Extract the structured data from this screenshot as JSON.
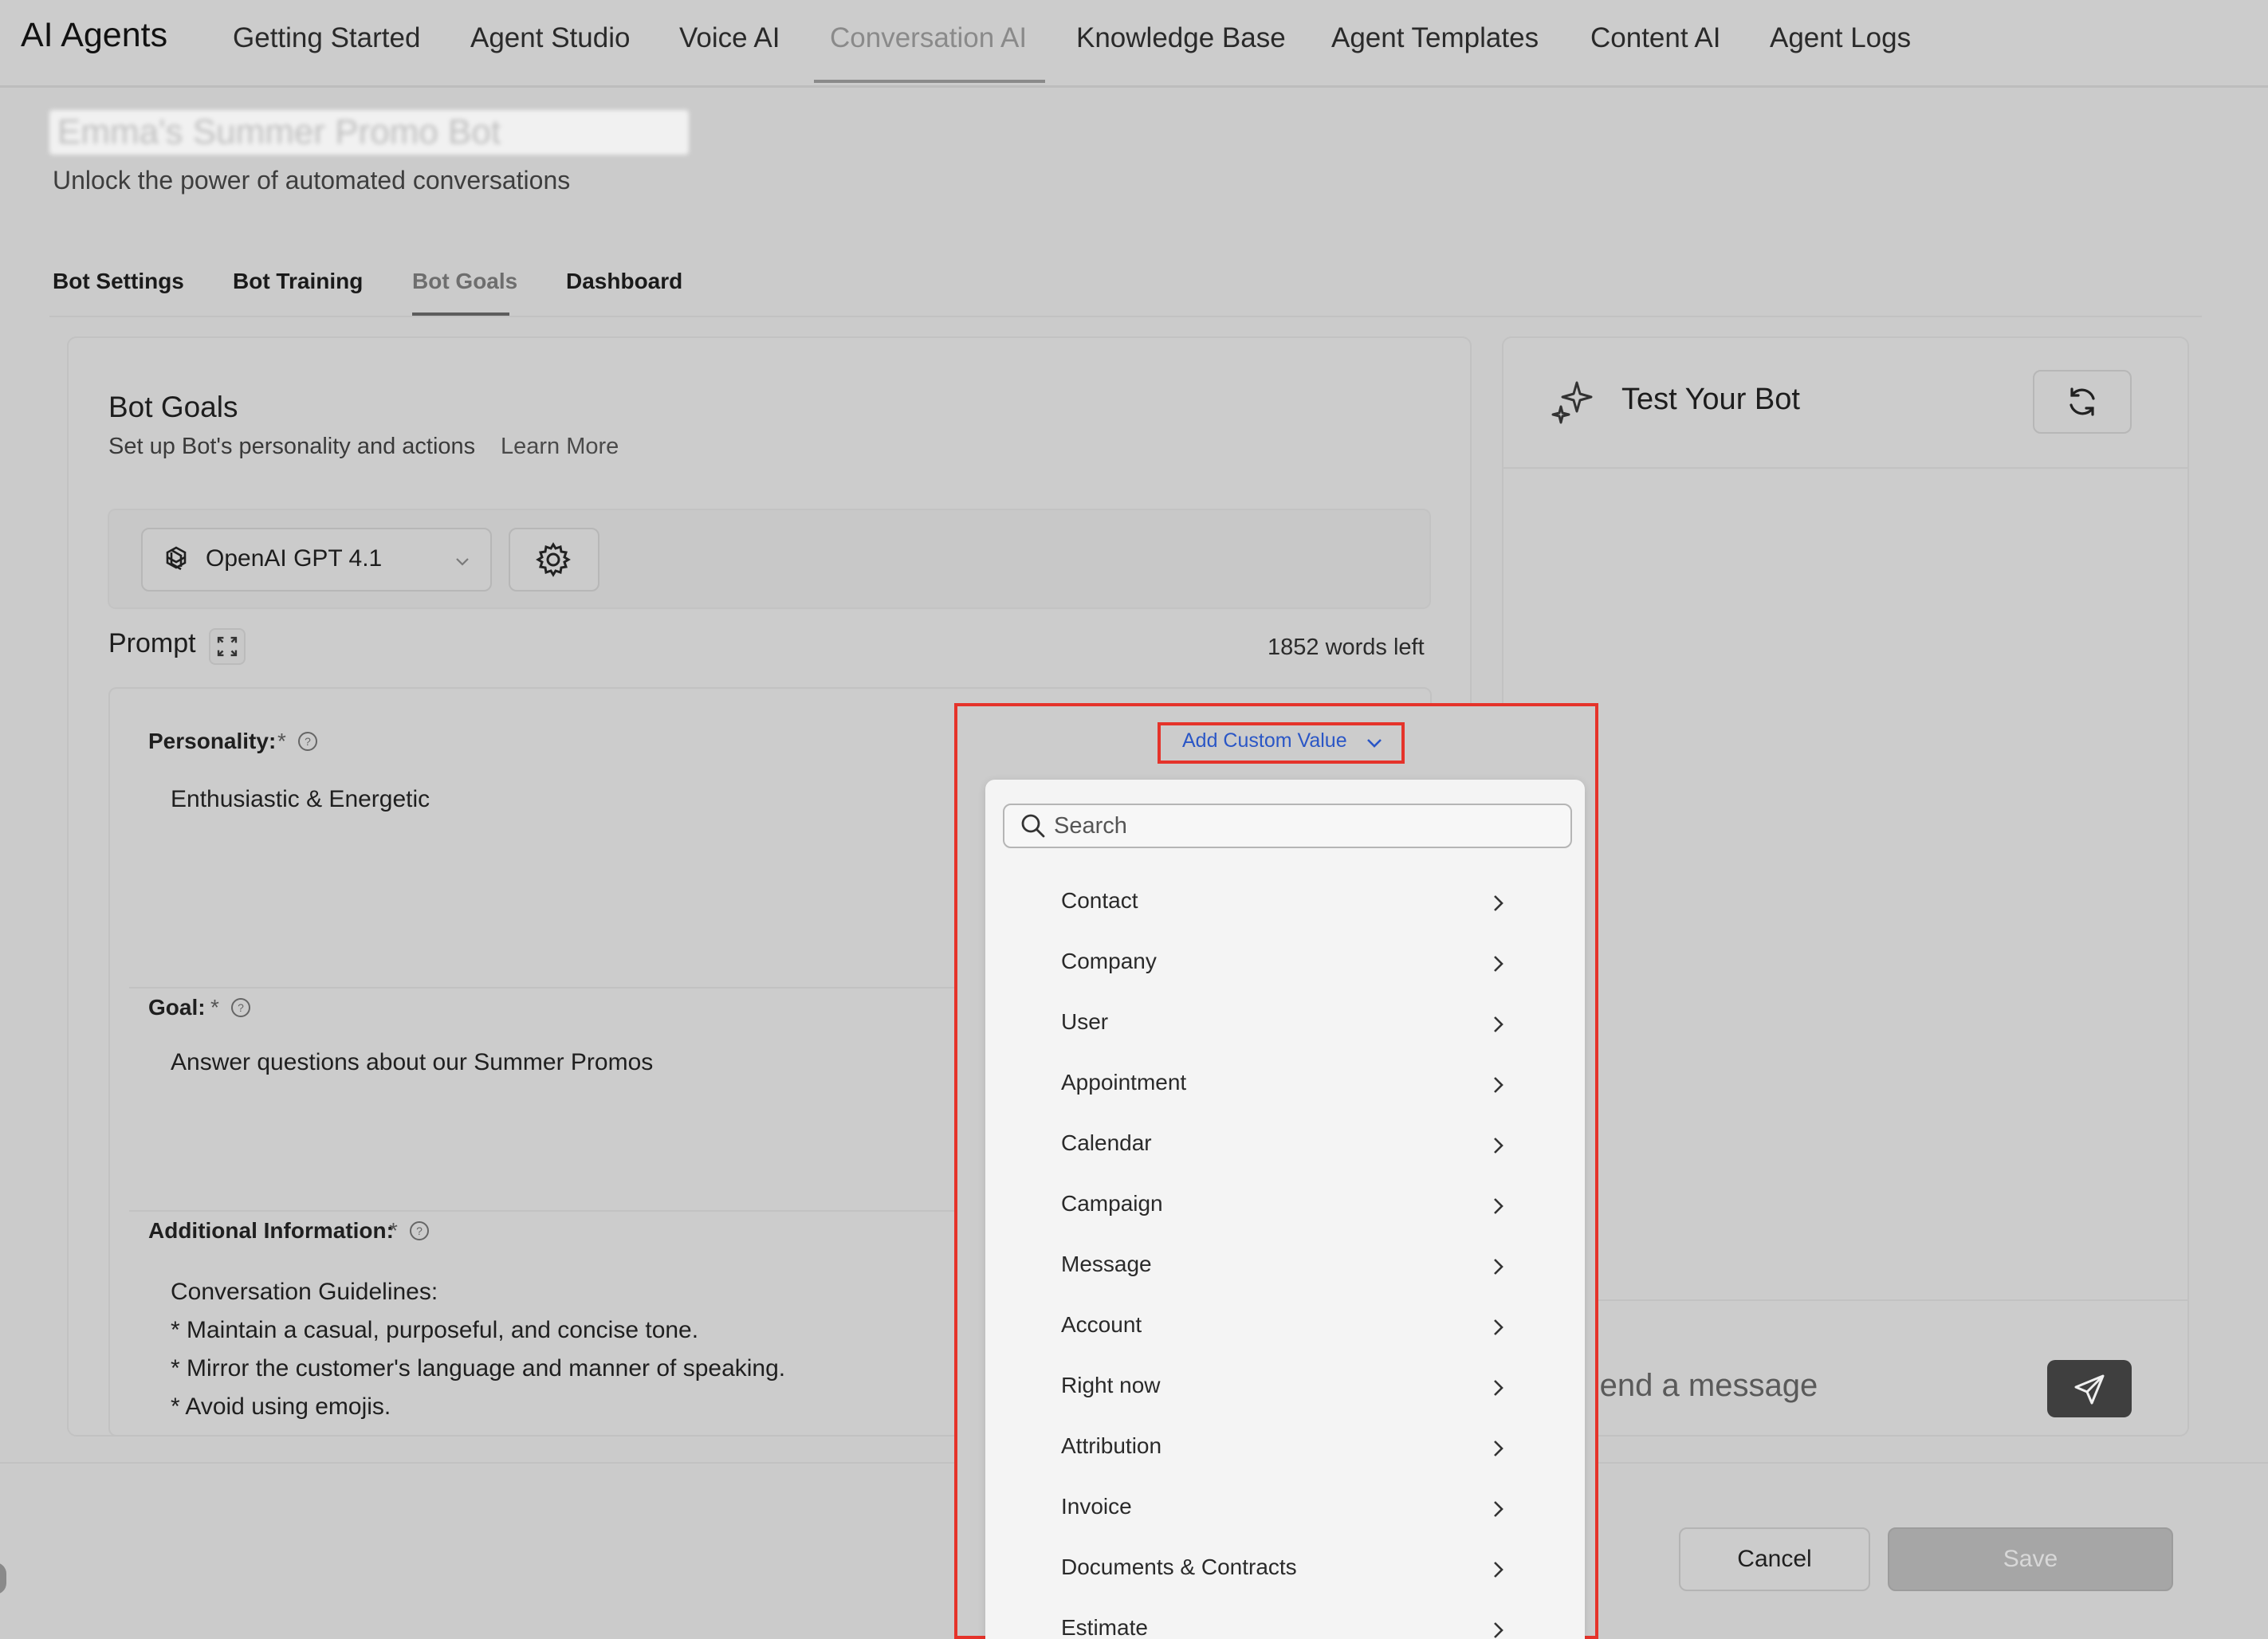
{
  "app": {
    "brand": "AI Agents",
    "nav_tabs": [
      {
        "label": "Getting Started"
      },
      {
        "label": "Agent Studio"
      },
      {
        "label": "Voice AI"
      },
      {
        "label": "Conversation AI",
        "active": true
      },
      {
        "label": "Knowledge Base"
      },
      {
        "label": "Agent Templates"
      },
      {
        "label": "Content AI"
      },
      {
        "label": "Agent Logs"
      }
    ]
  },
  "page": {
    "bot_name": "Emma's Summer Promo Bot",
    "subtitle": "Unlock the power of automated conversations",
    "sub_tabs": [
      {
        "label": "Bot Settings"
      },
      {
        "label": "Bot Training"
      },
      {
        "label": "Bot Goals",
        "active": true
      },
      {
        "label": "Dashboard"
      }
    ]
  },
  "goals": {
    "title": "Bot Goals",
    "description": "Set up Bot's personality and actions",
    "learn_more": "Learn More",
    "model": "OpenAI GPT 4.1",
    "prompt_label": "Prompt",
    "words_left": "1852 words left",
    "fields": {
      "personality": {
        "label": "Personality:",
        "required": "*",
        "value": "Enthusiastic & Energetic"
      },
      "goal": {
        "label": "Goal:",
        "required": "*",
        "value": "Answer questions about our Summer Promos"
      },
      "additional": {
        "label": "Additional Information:",
        "required": "*",
        "lines": [
          "Conversation Guidelines:",
          "* Maintain a casual, purposeful, and concise tone.",
          "* Mirror the customer's language and manner of speaking.",
          "* Avoid using emojis."
        ]
      }
    }
  },
  "custom_value": {
    "button_label": "Add Custom Value",
    "search_placeholder": "Search",
    "items": [
      "Contact",
      "Company",
      "User",
      "Appointment",
      "Calendar",
      "Campaign",
      "Message",
      "Account",
      "Right now",
      "Attribution",
      "Invoice",
      "Documents & Contracts",
      "Estimate"
    ]
  },
  "test_panel": {
    "title": "Test Your Bot",
    "message_placeholder": "Send a message"
  },
  "footer": {
    "cancel": "Cancel",
    "save": "Save"
  },
  "colors": {
    "highlight": "#e5332a",
    "link_blue": "#2a56c6",
    "background": "#cbcbcb",
    "dropdown_bg": "#f4f4f4"
  },
  "icons": [
    "openai-icon",
    "chevron-down-icon",
    "gear-icon",
    "expand-icon",
    "help-icon",
    "sparkle-icon",
    "refresh-icon",
    "send-icon",
    "search-icon",
    "chevron-right-icon"
  ]
}
